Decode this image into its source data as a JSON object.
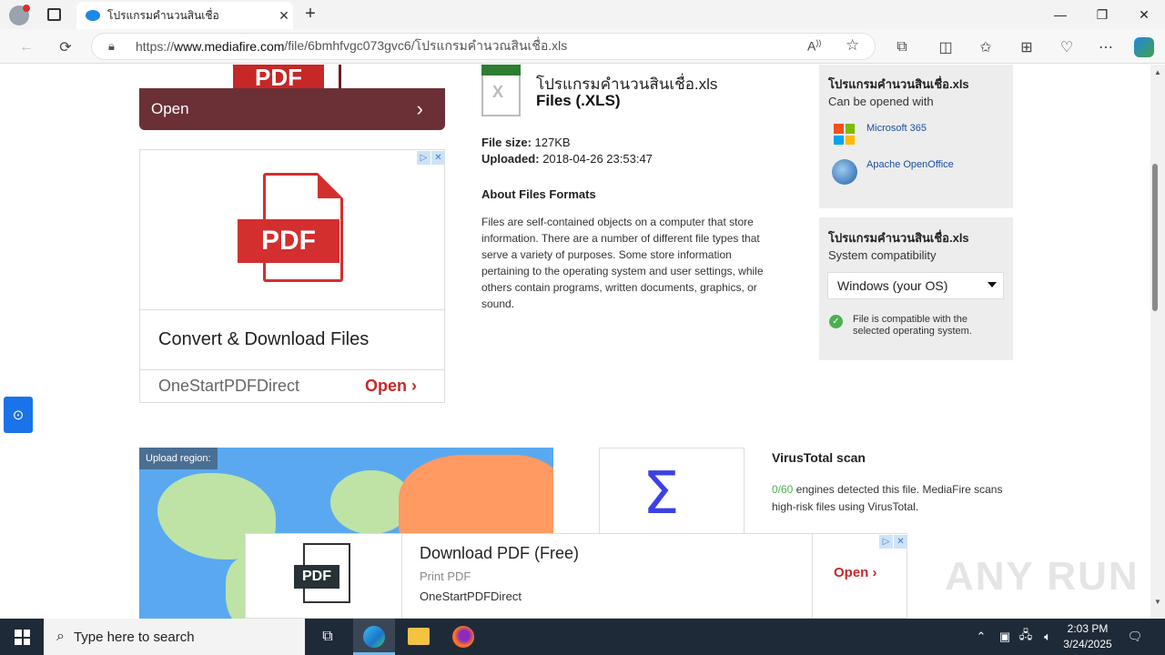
{
  "browser": {
    "tab_title": "โปรแกรมคำนวนสินเชื่อ",
    "url_prefix": "https://",
    "url_host": "www.mediafire.com",
    "url_path": "/file/6bmhfvgc073gvc6/โปรแกรมคำนวณสินเชื่อ.xls"
  },
  "left_ad_top": {
    "open_label": "Open",
    "pdf_label": "PDF"
  },
  "left_ad": {
    "pdf_label": "PDF",
    "headline": "Convert & Download Files",
    "brand": "OneStartPDFDirect",
    "open_label": "Open"
  },
  "file": {
    "name": "โปรแกรมคำนวนสินเชื่อ.xls",
    "type": "Files (.XLS)",
    "size_label": "File size:",
    "size_value": "127KB",
    "uploaded_label": "Uploaded:",
    "uploaded_value": "2018-04-26 23:53:47",
    "about_title": "About Files Formats",
    "about_text": "Files are self-contained objects on a computer that store information. There are a number of different file types that serve a variety of purposes. Some store information pertaining to the operating system and user settings, while others contain programs, written documents, graphics, or sound."
  },
  "open_with": {
    "title": "โปรแกรมคำนวนสินเชื่อ.xls",
    "subtitle": "Can be opened with",
    "apps": [
      "Microsoft 365",
      "Apache OpenOffice"
    ]
  },
  "compat": {
    "title": "โปรแกรมคำนวนสินเชื่อ.xls",
    "subtitle": "System compatibility",
    "selected_os": "Windows (your OS)",
    "status": "File is compatible with the selected operating system."
  },
  "map": {
    "label": "Upload region:"
  },
  "virustotal": {
    "title": "VirusTotal scan",
    "count": "0/60",
    "text": " engines detected this file. MediaFire scans high-risk files using VirusTotal."
  },
  "bottom_ad": {
    "pdf_label": "PDF",
    "headline": "Download PDF (Free)",
    "subline": "Print PDF",
    "brand": "OneStartPDFDirect",
    "open_label": "Open"
  },
  "watermark": "ANY RUN",
  "taskbar": {
    "search_placeholder": "Type here to search",
    "time": "2:03 PM",
    "date": "3/24/2025"
  },
  "colors": {
    "accent_red": "#c62828",
    "mediafire_blue": "#1a73e8",
    "green": "#4caf50"
  }
}
